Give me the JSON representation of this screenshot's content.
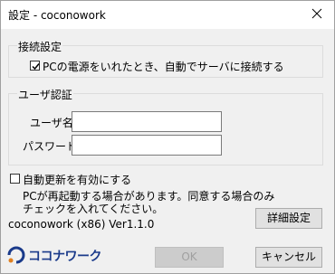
{
  "window": {
    "title": "設定 - coconowork"
  },
  "connection_group": {
    "legend": "接続設定",
    "auto_connect_label": "PCの電源をいれたとき、自動でサーバに接続する",
    "auto_connect_checked": true
  },
  "auth_group": {
    "legend": "ユーザ認証",
    "username_label": "ユーザ名",
    "username_value": "",
    "password_label": "パスワード",
    "password_value": ""
  },
  "auto_update": {
    "label": "自動更新を有効にする",
    "checked": false,
    "note_line1": "PCが再起動する場合があります。同意する場合のみ",
    "note_line2": "チェックを入れてください。"
  },
  "version_text": "coconowork (x86) Ver1.1.0",
  "buttons": {
    "details": "詳細設定",
    "ok": "OK",
    "cancel": "キャンセル"
  },
  "logo": {
    "text": "ココナワーク"
  },
  "colors": {
    "logo_primary": "#1a3a8a",
    "logo_accent": "#e08020"
  }
}
